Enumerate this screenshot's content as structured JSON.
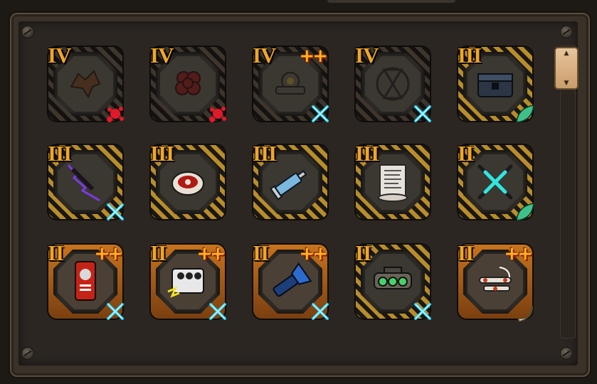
{
  "panel": {
    "scrollbar": {
      "position": 0.0
    }
  },
  "slots": [
    {
      "tier": "IV",
      "plus": "",
      "icon": "dark-leaf-relic-icon",
      "corner": "blood-splat-icon",
      "style": "dim"
    },
    {
      "tier": "IV",
      "plus": "",
      "icon": "dark-flower-relic-icon",
      "corner": "blood-splat-icon",
      "style": "dim"
    },
    {
      "tier": "IV",
      "plus": "++",
      "icon": "dark-gear-cluster-icon",
      "corner": "cyan-cross-icon",
      "style": "dim"
    },
    {
      "tier": "IV",
      "plus": "",
      "icon": "dark-hourglass-icon",
      "corner": "cyan-cross-icon",
      "style": "dim"
    },
    {
      "tier": "III",
      "plus": "",
      "icon": "metal-chest-icon",
      "corner": "green-leaf-icon",
      "style": "hazard"
    },
    {
      "tier": "III",
      "plus": "",
      "icon": "purple-lightning-blade-icon",
      "corner": "cyan-cross-icon",
      "style": "hazard"
    },
    {
      "tier": "III",
      "plus": "",
      "icon": "bloody-bowl-icon",
      "corner": "",
      "style": "hazard"
    },
    {
      "tier": "III",
      "plus": "",
      "icon": "syringe-icon",
      "corner": "",
      "style": "hazard"
    },
    {
      "tier": "III",
      "plus": "",
      "icon": "scroll-icon",
      "corner": "",
      "style": "hazard"
    },
    {
      "tier": "II",
      "plus": "",
      "icon": "crossed-cyan-blades-icon",
      "corner": "green-leaf-icon",
      "style": "hazard"
    },
    {
      "tier": "II",
      "plus": "++",
      "icon": "red-dog-tag-icon",
      "corner": "cyan-cross-icon",
      "style": "orange"
    },
    {
      "tier": "II",
      "plus": "++",
      "icon": "electric-battery-icon",
      "corner": "cyan-cross-icon",
      "style": "orange"
    },
    {
      "tier": "II",
      "plus": "++",
      "icon": "blue-flashlight-icon",
      "corner": "cyan-cross-icon",
      "style": "orange"
    },
    {
      "tier": "II",
      "plus": "",
      "icon": "night-vision-goggles-icon",
      "corner": "cyan-cross-icon",
      "style": "hazard"
    },
    {
      "tier": "II",
      "plus": "++",
      "icon": "bone-bundle-icon",
      "corner": "tusk-icon",
      "style": "orange"
    }
  ]
}
